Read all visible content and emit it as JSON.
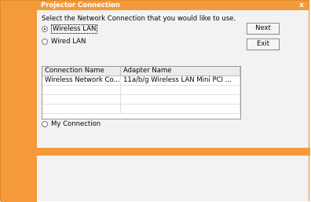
{
  "window": {
    "title": "Projector Connection",
    "close_glyph": "x",
    "accent_color": "#f59a3a"
  },
  "instruction": "Select the Network Connection that you would like to use.",
  "buttons": {
    "next": "Next",
    "exit": "Exit"
  },
  "options": {
    "wireless_lan": {
      "label": "Wireless LAN",
      "selected": true
    },
    "wired_lan": {
      "label": "Wired LAN",
      "selected": false
    },
    "my_connection": {
      "label": "My Connection",
      "selected": false
    }
  },
  "list": {
    "columns": [
      "Connection Name",
      "Adapter Name"
    ],
    "rows": [
      [
        "Wireless Network Co...",
        "11a/b/g Wireless LAN Mini PCI ..."
      ],
      [
        "",
        ""
      ],
      [
        "",
        ""
      ],
      [
        "",
        ""
      ]
    ]
  }
}
